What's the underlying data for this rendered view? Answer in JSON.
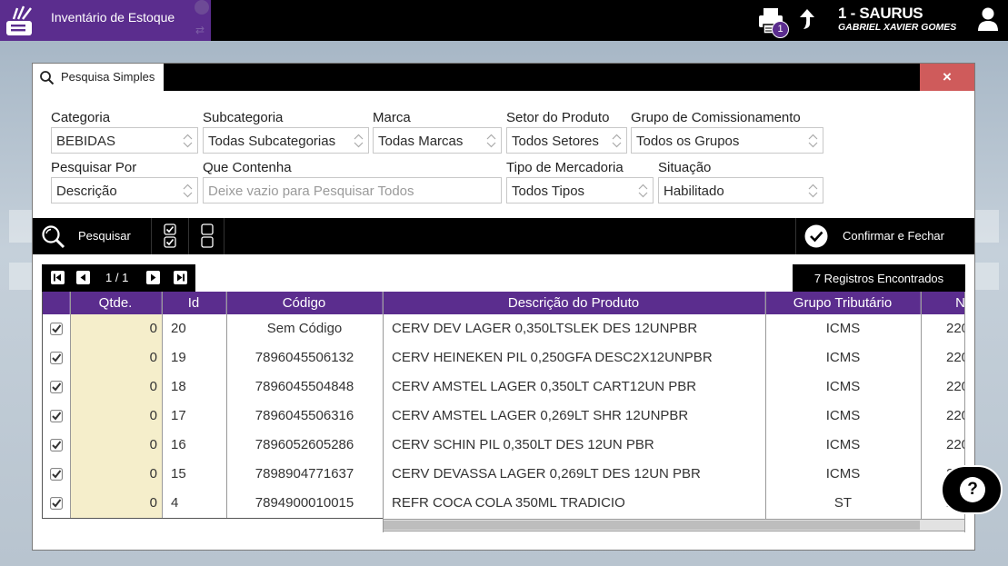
{
  "app": {
    "title": "Inventário de Estoque",
    "company": "1 - SAURUS",
    "user": "GABRIEL XAVIER GOMES",
    "print_badge": "1",
    "accent_color": "#5b2d8e"
  },
  "dialog": {
    "tab_label": "Pesquisa Simples",
    "close_label": "×",
    "close_color": "#cf5b5b"
  },
  "filters": {
    "categoria": {
      "label": "Categoria",
      "value": "BEBIDAS"
    },
    "subcategoria": {
      "label": "Subcategoria",
      "value": "Todas Subcategorias"
    },
    "marca": {
      "label": "Marca",
      "value": "Todas Marcas"
    },
    "setor": {
      "label": "Setor do Produto",
      "value": "Todos Setores"
    },
    "grupo": {
      "label": "Grupo de Comissionamento",
      "value": "Todos os Grupos"
    },
    "pesquisar_por": {
      "label": "Pesquisar Por",
      "value": "Descrição"
    },
    "que_contenha": {
      "label": "Que Contenha",
      "placeholder": "Deixe vazio para Pesquisar Todos"
    },
    "tipo_mercadoria": {
      "label": "Tipo de Mercadoria",
      "value": "Todos Tipos"
    },
    "situacao": {
      "label": "Situação",
      "value": "Habilitado"
    }
  },
  "actions": {
    "search_label": "Pesquisar",
    "confirm_label": "Confirmar e Fechar"
  },
  "pager": {
    "text": "1 / 1"
  },
  "records_label": "7 Registros Encontrados",
  "table": {
    "columns": [
      "Qtde.",
      "Id",
      "Código",
      "Descrição do Produto",
      "Grupo Tributário",
      "N"
    ],
    "rows": [
      {
        "qtde": "0",
        "id": "20",
        "codigo": "Sem Código",
        "descricao": "CERV DEV LAGER 0,350LTSLEK DES 12UNPBR",
        "grupo": "ICMS",
        "next": "220",
        "checked": true
      },
      {
        "qtde": "0",
        "id": "19",
        "codigo": "7896045506132",
        "descricao": "CERV HEINEKEN PIL 0,250GFA DESC2X12UNPBR",
        "grupo": "ICMS",
        "next": "220",
        "checked": true
      },
      {
        "qtde": "0",
        "id": "18",
        "codigo": "7896045504848",
        "descricao": "CERV AMSTEL LAGER 0,350LT CART12UN PBR",
        "grupo": "ICMS",
        "next": "220",
        "checked": true
      },
      {
        "qtde": "0",
        "id": "17",
        "codigo": "7896045506316",
        "descricao": "CERV AMSTEL LAGER 0,269LT SHR 12UNPBR",
        "grupo": "ICMS",
        "next": "220",
        "checked": true
      },
      {
        "qtde": "0",
        "id": "16",
        "codigo": "7896052605286",
        "descricao": "CERV SCHIN PIL 0,350LT DES 12UN PBR",
        "grupo": "ICMS",
        "next": "220",
        "checked": true
      },
      {
        "qtde": "0",
        "id": "15",
        "codigo": "7898904771637",
        "descricao": "CERV DEVASSA LAGER 0,269LT DES 12UN PBR",
        "grupo": "ICMS",
        "next": "2",
        "checked": true
      },
      {
        "qtde": "0",
        "id": "4",
        "codigo": "7894900010015",
        "descricao": "REFR COCA COLA 350ML TRADICIO",
        "grupo": "ST",
        "next": "2",
        "checked": true
      }
    ]
  },
  "help": {
    "glyph": "?"
  }
}
